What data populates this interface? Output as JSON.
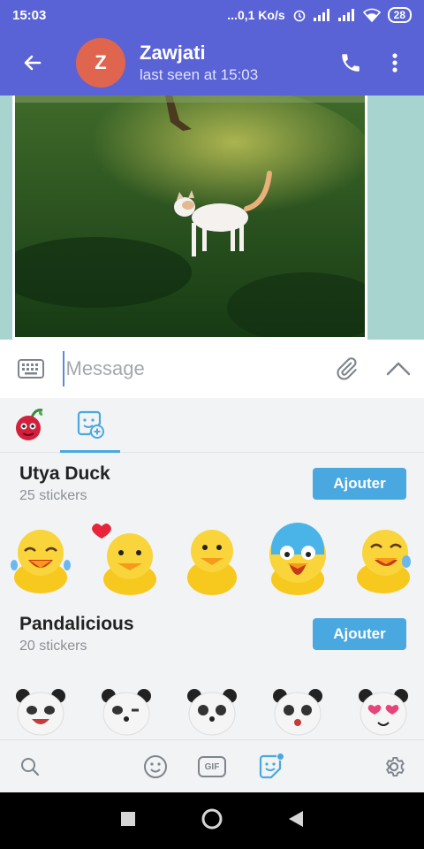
{
  "status_bar": {
    "time": "15:03",
    "network_speed": "...0,1 Ko/s",
    "battery": "28"
  },
  "toolbar": {
    "avatar_letter": "Z",
    "name": "Zawjati",
    "status": "last seen at 15:03"
  },
  "input": {
    "placeholder": "Message"
  },
  "sticker_tabs": [
    {
      "name": "cherry-sticker-pack",
      "active": false
    },
    {
      "name": "add-stickers",
      "active": true
    }
  ],
  "packs": [
    {
      "name": "Utya Duck",
      "count": "25 stickers",
      "button": "Ajouter"
    },
    {
      "name": "Pandalicious",
      "count": "20 stickers",
      "button": "Ajouter"
    }
  ],
  "bottom_bar": {
    "gif_label": "GIF"
  },
  "colors": {
    "header": "#5a63d6",
    "avatar": "#e0654f",
    "accent": "#4aa8e0",
    "chat_background": "#a8d4cf"
  }
}
